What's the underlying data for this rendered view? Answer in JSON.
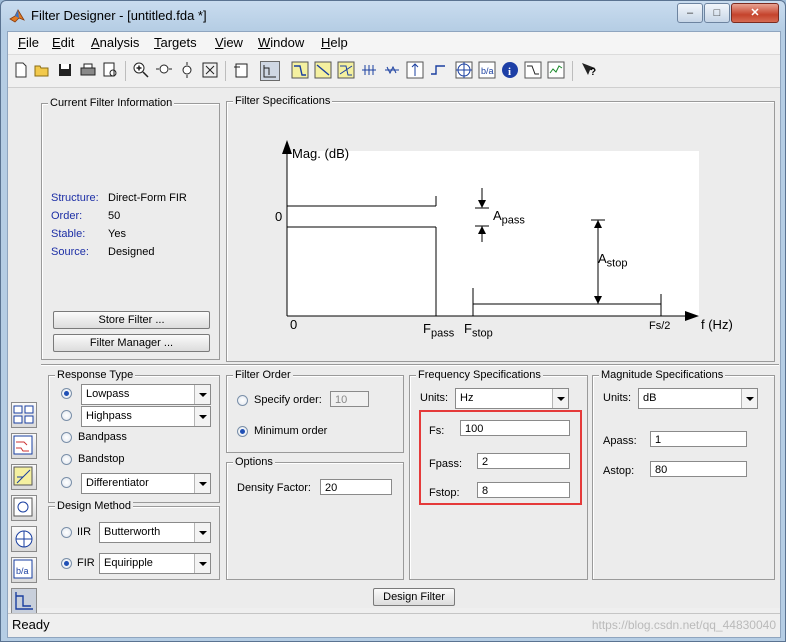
{
  "window": {
    "title": "Filter Designer -  [untitled.fda *]"
  },
  "menu": [
    "File",
    "Edit",
    "Analysis",
    "Targets",
    "View",
    "Window",
    "Help"
  ],
  "current_info": {
    "group": "Current Filter Information",
    "structure_label": "Structure:",
    "structure": "Direct-Form FIR",
    "order_label": "Order:",
    "order": "50",
    "stable_label": "Stable:",
    "stable": "Yes",
    "source_label": "Source:",
    "source": "Designed",
    "store_btn": "Store Filter ...",
    "manager_btn": "Filter Manager ..."
  },
  "specs": {
    "group": "Filter Specifications",
    "ylabel": "Mag. (dB)",
    "zero_y": "0",
    "zero_x": "0",
    "a_main": "A",
    "a_pass_sub": "pass",
    "a_stop_sub": "stop",
    "f_main": "F",
    "f_pass_sub": "pass",
    "f_stop_sub": "stop",
    "fs2": "Fs/2",
    "xunit": "f (Hz)"
  },
  "response": {
    "group": "Response Type",
    "lowpass": "Lowpass",
    "highpass": "Highpass",
    "bandpass": "Bandpass",
    "bandstop": "Bandstop",
    "differentiator": "Differentiator",
    "selected": "Lowpass"
  },
  "design": {
    "group": "Design Method",
    "iir_label": "IIR",
    "iir_value": "Butterworth",
    "fir_label": "FIR",
    "fir_value": "Equiripple",
    "selected": "FIR"
  },
  "order": {
    "group": "Filter Order",
    "specify_label": "Specify order:",
    "specify_value": "10",
    "minimum_label": "Minimum order",
    "selected": "Minimum order"
  },
  "options": {
    "group": "Options",
    "density_label": "Density Factor:",
    "density_value": "20"
  },
  "freq": {
    "group": "Frequency Specifications",
    "units_label": "Units:",
    "units": "Hz",
    "fs_label": "Fs:",
    "fs": "100",
    "fpass_label": "Fpass:",
    "fpass": "2",
    "fstop_label": "Fstop:",
    "fstop": "8"
  },
  "mag": {
    "group": "Magnitude Specifications",
    "units_label": "Units:",
    "units": "dB",
    "apass_label": "Apass:",
    "apass": "1",
    "astop_label": "Astop:",
    "astop": "80"
  },
  "design_button": "Design Filter",
  "status": "Ready",
  "watermark": "https://blog.csdn.net/qq_44830040",
  "colors": {
    "accent": "#1f4fb5",
    "highlight": "#e53a3a",
    "label_blue": "#1d2fa6"
  },
  "icons": {
    "titlebar": "matlab-logo-icon",
    "toolbar": [
      "new-icon",
      "open-icon",
      "save-icon",
      "print-icon",
      "print-preview-icon",
      "zoom-in-icon",
      "zoom-x-icon",
      "zoom-y-icon",
      "full-view-icon",
      "new-figure-icon",
      "filter-specs-icon",
      "magnitude-response-icon",
      "phase-response-icon",
      "mag-phase-icon",
      "group-delay-icon",
      "phase-delay-icon",
      "impulse-response-icon",
      "step-response-icon",
      "pole-zero-icon",
      "coefficients-icon",
      "info-icon",
      "magnitude-estimate-icon",
      "noise-psd-icon",
      "whats-this-icon"
    ],
    "sidebar": [
      "transform-filter-icon",
      "quantize-icon",
      "realize-model-icon",
      "import-filter-icon",
      "pole-zero-editor-icon",
      "multirate-icon",
      "design-filter-icon"
    ]
  }
}
